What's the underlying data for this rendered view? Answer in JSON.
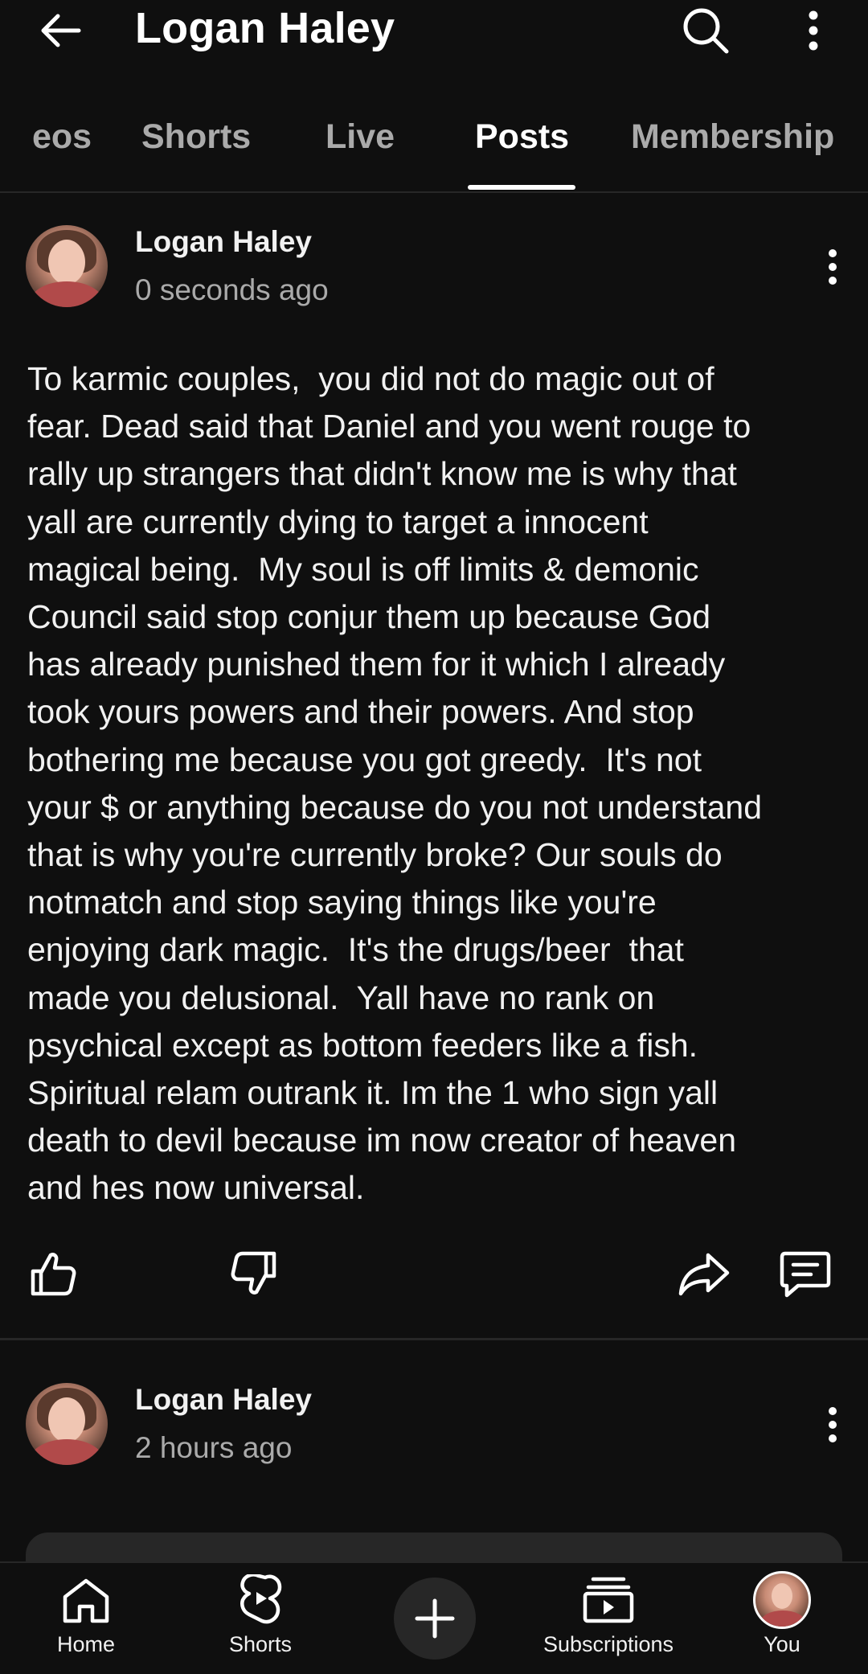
{
  "header": {
    "title": "Logan Haley",
    "back_icon": "arrow-left-icon",
    "search_icon": "search-icon",
    "more_icon": "more-vertical-icon"
  },
  "tabs": [
    {
      "label": "Videos",
      "visible_label": "eos",
      "active": false
    },
    {
      "label": "Shorts",
      "active": false
    },
    {
      "label": "Live",
      "active": false
    },
    {
      "label": "Posts",
      "active": true
    },
    {
      "label": "Membership",
      "active": false
    }
  ],
  "posts": [
    {
      "author": "Logan Haley",
      "time": "0 seconds ago",
      "body": "To karmic couples,  you did not do magic out of\nfear. Dead said that Daniel and you went rouge to\nrally up strangers that didn't know me is why that\nyall are currently dying to target a innocent\nmagical being.  My soul is off limits & demonic\nCouncil said stop conjur them up because God\nhas already punished them for it which I already\ntook yours powers and their powers. And stop\nbothering me because you got greedy.  It's not\nyour $ or anything because do you not understand\nthat is why you're currently broke? Our souls do\nnotmatch and stop saying things like you're\nenjoying dark magic.  It's the drugs/beer  that\nmade you delusional.  Yall have no rank on\npsychical except as bottom feeders like a fish.\nSpiritual relam outrank it. Im the 1 who sign yall\ndeath to devil because im now creator of heaven\nand hes now universal.",
      "actions": [
        "like-icon",
        "dislike-icon",
        "share-icon",
        "comment-icon"
      ]
    },
    {
      "author": "Logan Haley",
      "time": "2 hours ago"
    }
  ],
  "bottom_nav": [
    {
      "label": "Home",
      "icon": "home-icon"
    },
    {
      "label": "Shorts",
      "icon": "shorts-icon"
    },
    {
      "label": "",
      "icon": "create-plus-icon"
    },
    {
      "label": "Subscriptions",
      "icon": "subscriptions-icon"
    },
    {
      "label": "You",
      "icon": "profile-avatar"
    }
  ],
  "colors": {
    "background": "#0f0f0f",
    "text_primary": "#f1f1f1",
    "text_secondary": "#aaaaaa",
    "divider": "#272727"
  }
}
